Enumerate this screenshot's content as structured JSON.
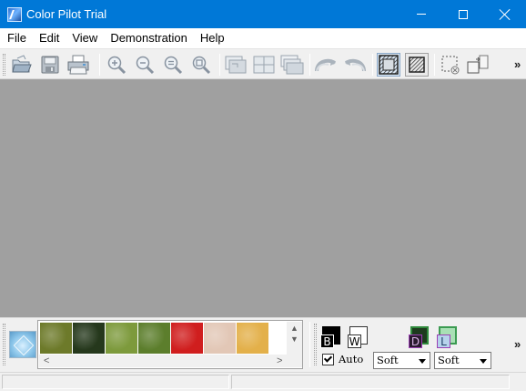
{
  "window": {
    "title": "Color Pilot Trial"
  },
  "menu": {
    "items": [
      "File",
      "Edit",
      "View",
      "Demonstration",
      "Help"
    ]
  },
  "toolbar": {
    "buttons": [
      "open-icon",
      "save-icon",
      "print-icon",
      "zoom-in-icon",
      "zoom-out-icon",
      "zoom-actual-icon",
      "zoom-fit-icon",
      "view-single-icon",
      "view-split-icon",
      "view-stack-icon",
      "undo-icon",
      "redo-icon",
      "mask-on-icon",
      "mask-hatch-icon",
      "selection-icon",
      "compare-icon"
    ],
    "overflow": "»"
  },
  "workspace": {
    "background": "#a0a0a0"
  },
  "palette": {
    "swatches": [
      {
        "name": "foliage-1",
        "color": "#6d7a2a"
      },
      {
        "name": "foliage-dark",
        "color": "#25381c"
      },
      {
        "name": "foliage-light",
        "color": "#7d9a3c"
      },
      {
        "name": "foliage-2",
        "color": "#5c7e2c"
      },
      {
        "name": "red",
        "color": "#d01e1e"
      },
      {
        "name": "skin",
        "color": "#e2c7b6"
      },
      {
        "name": "sand",
        "color": "#e3b04a"
      }
    ],
    "scroll_up": "▲",
    "scroll_down": "▼",
    "scroll_left": "<",
    "scroll_right": ">"
  },
  "modes": {
    "black_letter": "B",
    "white_letter": "W",
    "dark_letter": "D",
    "light_letter": "L",
    "auto_label": "Auto",
    "auto_checked": true,
    "dropdown1": "Soft",
    "dropdown2": "Soft",
    "overflow": "»"
  },
  "colors": {
    "titlebar": "#0078d7",
    "accent_purple": "#9b3fb5",
    "accent_green": "#3c9b52"
  }
}
